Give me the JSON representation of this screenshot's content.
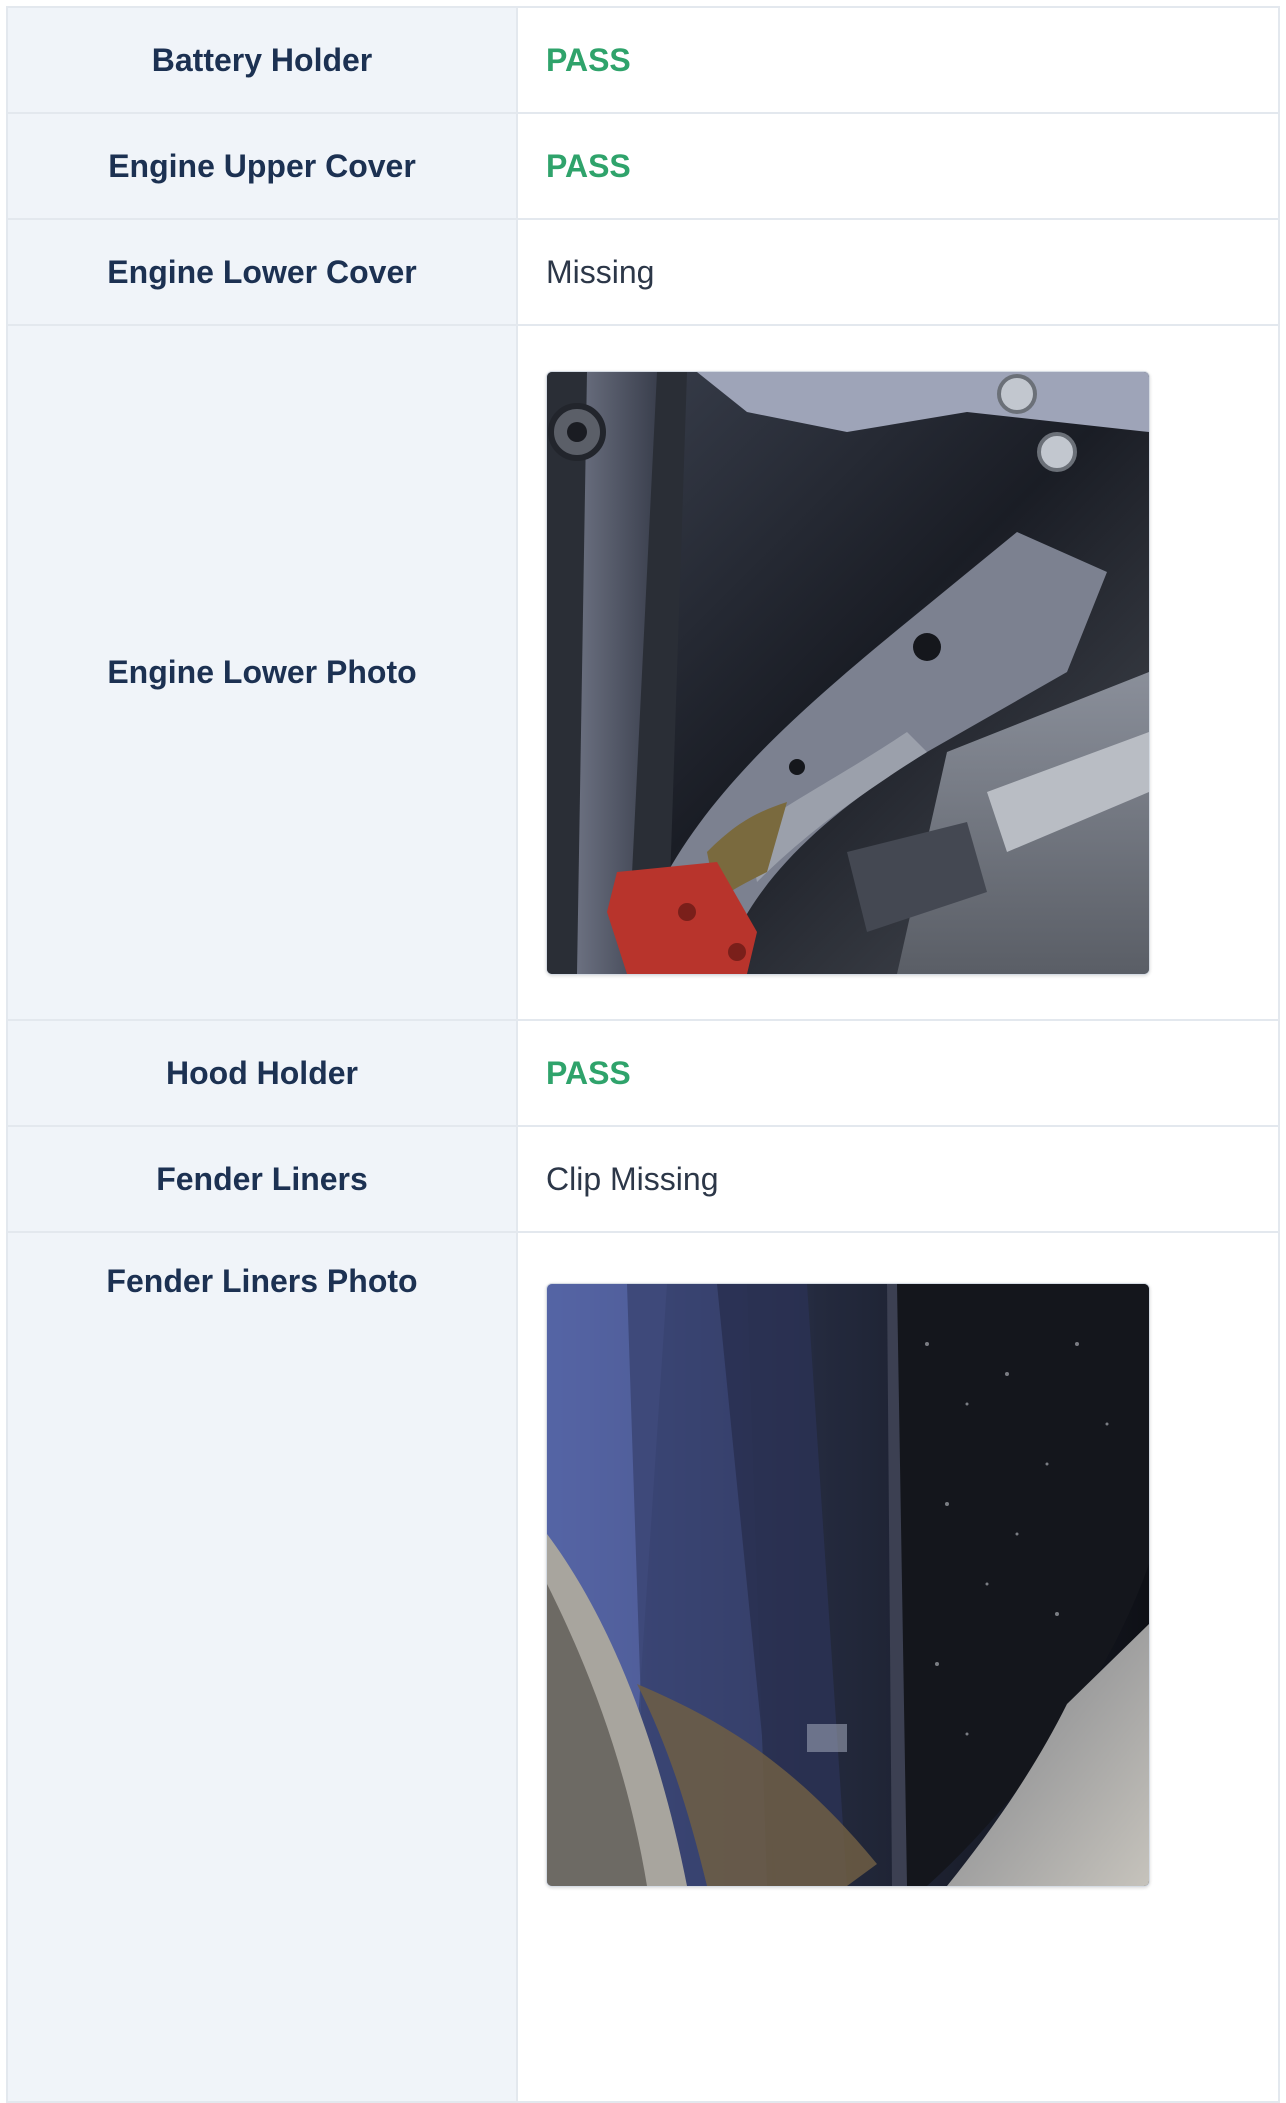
{
  "rows": [
    {
      "label": "Battery Holder",
      "value": "PASS",
      "status": "pass"
    },
    {
      "label": "Engine Upper Cover",
      "value": "PASS",
      "status": "pass"
    },
    {
      "label": "Engine Lower Cover",
      "value": "Missing",
      "status": "note"
    },
    {
      "label": "Engine Lower Photo",
      "photo": "engine-underside-photo"
    },
    {
      "label": "Hood Holder",
      "value": "PASS",
      "status": "pass"
    },
    {
      "label": "Fender Liners",
      "value": "Clip Missing",
      "status": "note"
    },
    {
      "label": "Fender Liners Photo",
      "photo": "fender-liner-photo"
    }
  ],
  "colors": {
    "label_bg": "#f0f4f9",
    "label_text": "#1c3152",
    "pass_text": "#2fa36b",
    "value_text": "#2c3748",
    "border": "#e3e8ee"
  }
}
